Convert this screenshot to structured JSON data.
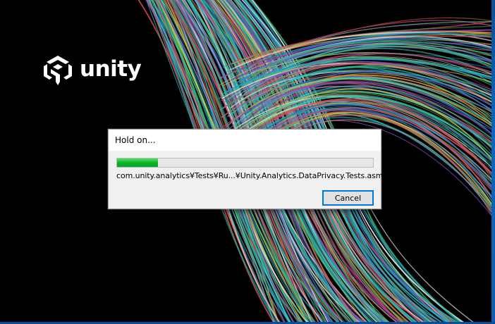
{
  "splash": {
    "logo_text": "unity",
    "logo_icon": "unity-cube-icon",
    "background_color": "#000000"
  },
  "dialog": {
    "title": "Hold on...",
    "progress": {
      "fraction": 0.16,
      "color": "#06b025"
    },
    "status_text": "com.unity.analytics¥Tests¥Ru...¥Unity.Analytics.DataPrivacy.Tests.asmdef",
    "cancel_label": "Cancel",
    "accent_color": "#0078d7"
  }
}
